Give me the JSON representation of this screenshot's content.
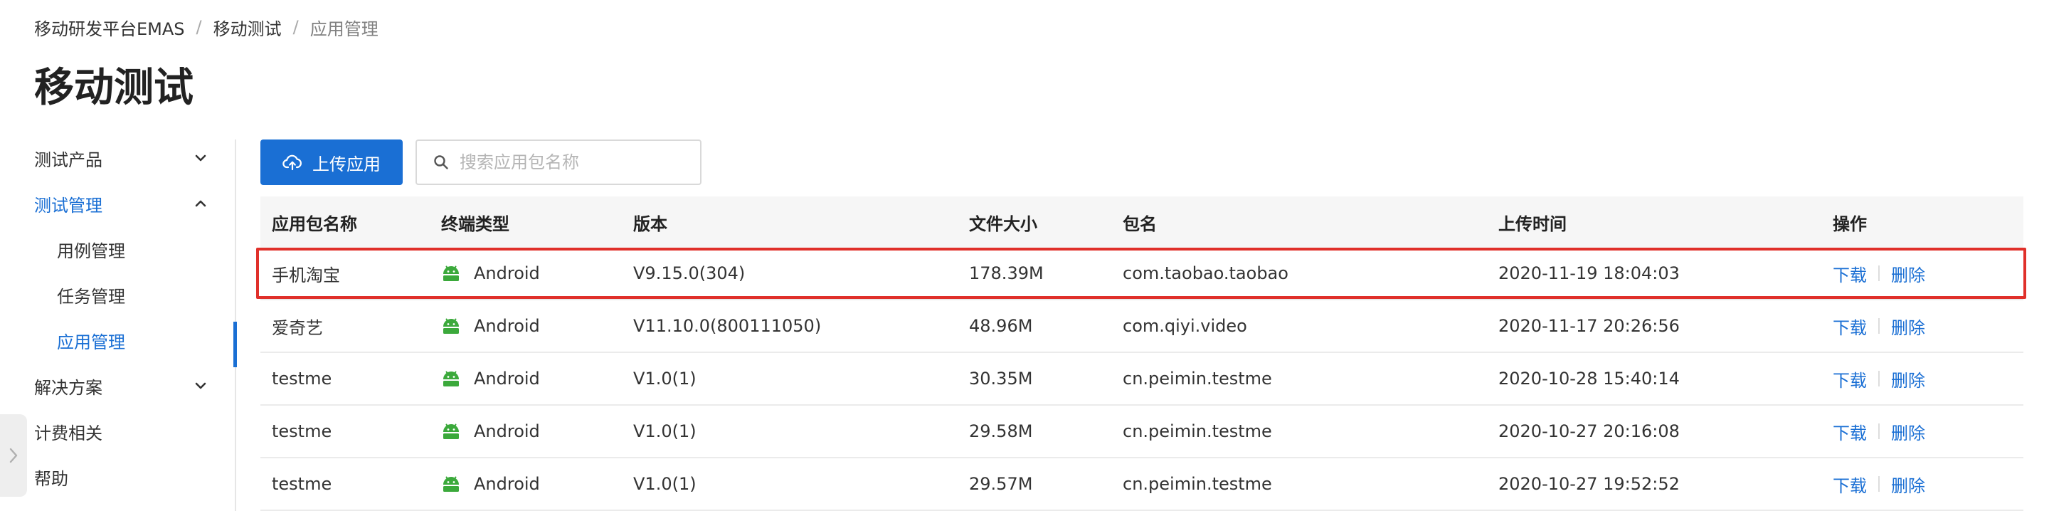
{
  "breadcrumb": [
    "移动研发平台EMAS",
    "移动测试",
    "应用管理"
  ],
  "breadcrumb_separator": "/",
  "page_title": "移动测试",
  "sidebar": {
    "items": [
      {
        "label": "测试产品"
      },
      {
        "label": "测试管理"
      },
      {
        "label": "用例管理"
      },
      {
        "label": "任务管理"
      },
      {
        "label": "应用管理"
      },
      {
        "label": "解决方案"
      },
      {
        "label": "计费相关"
      },
      {
        "label": "帮助"
      }
    ]
  },
  "toolbar": {
    "upload_label": "上传应用",
    "search_placeholder": "搜索应用包名称"
  },
  "table": {
    "columns": [
      "应用包名称",
      "终端类型",
      "版本",
      "文件大小",
      "包名",
      "上传时间",
      "操作"
    ],
    "rows": [
      {
        "name": "手机淘宝",
        "type": "Android",
        "version": "V9.15.0(304)",
        "size": "178.39M",
        "package": "com.taobao.taobao",
        "time": "2020-11-19 18:04:03"
      },
      {
        "name": "爱奇艺",
        "type": "Android",
        "version": "V11.10.0(800111050)",
        "size": "48.96M",
        "package": "com.qiyi.video",
        "time": "2020-11-17 20:26:56"
      },
      {
        "name": "testme",
        "type": "Android",
        "version": "V1.0(1)",
        "size": "30.35M",
        "package": "cn.peimin.testme",
        "time": "2020-10-28 15:40:14"
      },
      {
        "name": "testme",
        "type": "Android",
        "version": "V1.0(1)",
        "size": "29.58M",
        "package": "cn.peimin.testme",
        "time": "2020-10-27 20:16:08"
      },
      {
        "name": "testme",
        "type": "Android",
        "version": "V1.0(1)",
        "size": "29.57M",
        "package": "cn.peimin.testme",
        "time": "2020-10-27 19:52:52"
      }
    ],
    "actions": {
      "download": "下载",
      "delete": "删除"
    }
  },
  "colors": {
    "accent": "#1a6fd4",
    "android": "#3ba93b",
    "highlight": "#e0302a"
  },
  "icons": {
    "upload": "cloud-upload-icon",
    "search": "search-icon",
    "terminal": "android-icon",
    "expand": "chevron-down-icon",
    "collapse": "chevron-up-icon"
  }
}
